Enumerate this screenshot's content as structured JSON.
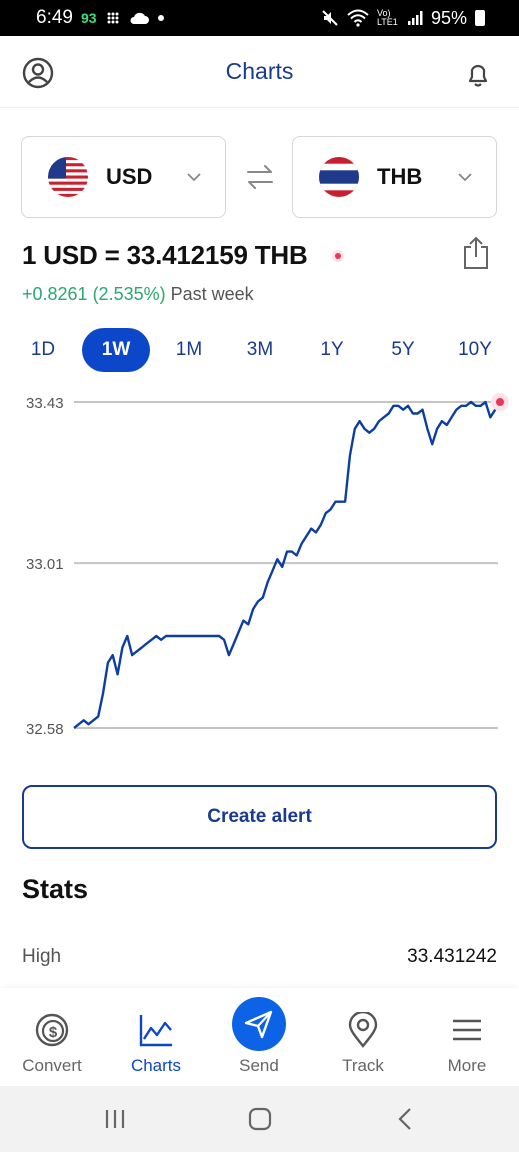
{
  "status": {
    "time": "6:49",
    "notif_count": "93",
    "battery": "95%",
    "network": "Vo) LTE1"
  },
  "header": {
    "title": "Charts"
  },
  "currencies": {
    "from": {
      "code": "USD"
    },
    "to": {
      "code": "THB"
    }
  },
  "rate": {
    "text": "1 USD = 33.412159 THB",
    "change": "+0.8261 (2.535%)",
    "period_label": "Past week"
  },
  "periods": [
    "1D",
    "1W",
    "1M",
    "3M",
    "1Y",
    "5Y",
    "10Y"
  ],
  "selected_period": "1W",
  "chart_data": {
    "type": "line",
    "title": "",
    "xlabel": "",
    "ylabel": "",
    "y_ticks": [
      "33.43",
      "33.01",
      "32.58"
    ],
    "ylim": [
      32.58,
      33.43
    ],
    "grid": true,
    "series": [
      {
        "values": [
          32.58,
          32.59,
          32.6,
          32.59,
          32.6,
          32.61,
          32.67,
          32.75,
          32.77,
          32.72,
          32.79,
          32.82,
          32.77,
          32.78,
          32.79,
          32.8,
          32.81,
          32.82,
          32.81,
          32.82,
          32.82,
          32.82,
          32.82,
          32.82,
          32.82,
          32.82,
          32.82,
          32.82,
          32.82,
          32.82,
          32.82,
          32.81,
          32.77,
          32.8,
          32.83,
          32.86,
          32.85,
          32.89,
          32.91,
          32.92,
          32.96,
          32.99,
          33.02,
          33.0,
          33.04,
          33.04,
          33.03,
          33.06,
          33.08,
          33.1,
          33.09,
          33.11,
          33.14,
          33.15,
          33.17,
          33.17,
          33.17,
          33.29,
          33.36,
          33.38,
          33.36,
          33.35,
          33.36,
          33.38,
          33.39,
          33.4,
          33.42,
          33.42,
          33.41,
          33.42,
          33.4,
          33.4,
          33.41,
          33.36,
          33.32,
          33.36,
          33.38,
          33.37,
          33.39,
          33.41,
          33.42,
          33.42,
          33.43,
          33.42,
          33.42,
          33.43,
          33.39,
          33.41,
          33.43
        ]
      }
    ],
    "line_color": "#0d3fa0",
    "end_marker_color": "#e8385a"
  },
  "alert_button": {
    "label": "Create alert"
  },
  "stats": {
    "title": "Stats",
    "rows": [
      {
        "label": "High",
        "value": "33.431242"
      }
    ]
  },
  "nav": {
    "items": [
      {
        "label": "Convert",
        "icon": "convert-icon"
      },
      {
        "label": "Charts",
        "icon": "charts-icon"
      },
      {
        "label": "Send",
        "icon": "send-icon"
      },
      {
        "label": "Track",
        "icon": "location-pin-icon"
      },
      {
        "label": "More",
        "icon": "menu-icon"
      }
    ],
    "active": "Charts"
  },
  "colors": {
    "brand": "#1a3a8f",
    "accent": "#0d47c9",
    "positive": "#2aa871",
    "alert": "#e8385a"
  }
}
